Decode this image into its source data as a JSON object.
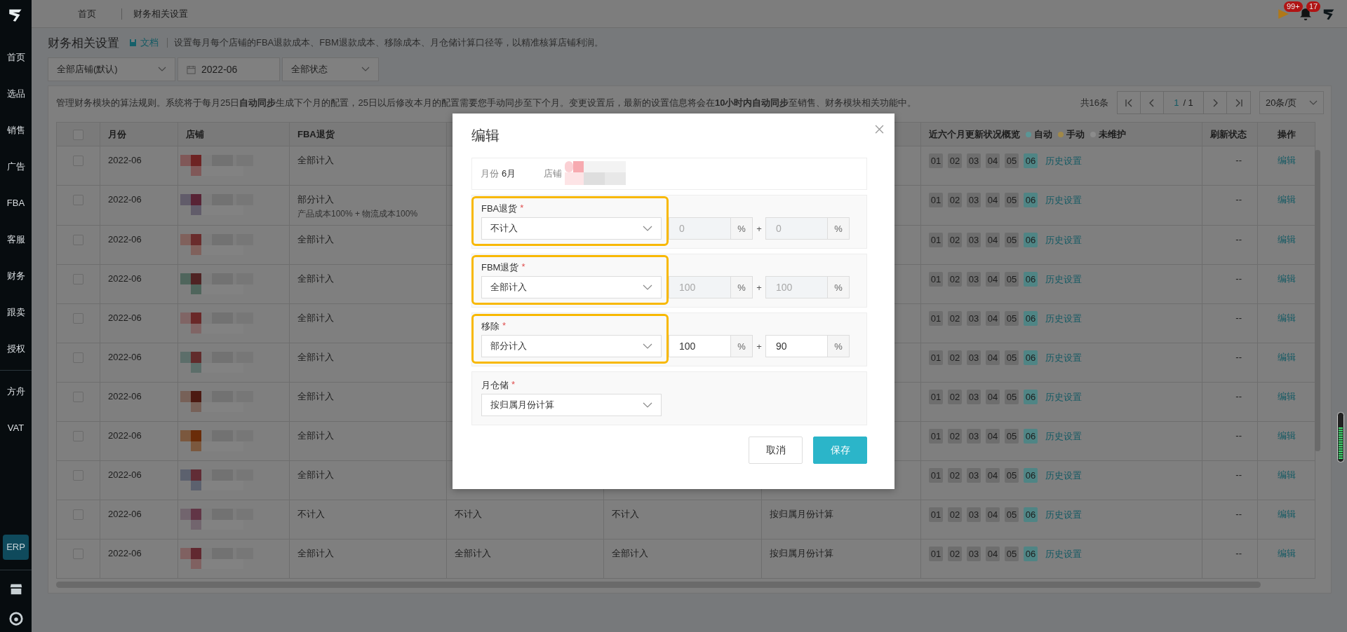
{
  "sidebar": {
    "nav_items": [
      {
        "label": "首页",
        "selected": false
      },
      {
        "label": "选品",
        "selected": false
      },
      {
        "label": "销售",
        "selected": false
      },
      {
        "label": "广告",
        "selected": false
      },
      {
        "label": "FBA",
        "selected": false
      },
      {
        "label": "客服",
        "selected": false
      },
      {
        "label": "财务",
        "selected": false
      },
      {
        "label": "跟卖",
        "selected": false
      },
      {
        "label": "授权",
        "selected": false
      }
    ],
    "extra_items": [
      {
        "label": "方舟",
        "selected": false
      },
      {
        "label": "VAT",
        "selected": false
      }
    ],
    "app_items": [
      {
        "label": "ERP",
        "selected": true
      }
    ]
  },
  "top_bar": {
    "tabs": [
      "首页",
      "财务相关设置"
    ],
    "flag_badge": "99+",
    "bell_badge": "17"
  },
  "page": {
    "title": "财务相关设置",
    "doc_link": "文档",
    "description": "设置每月每个店铺的FBA退款成本、FBM退款成本、移除成本、月仓储计算口径等，以精准核算店铺利润。"
  },
  "filters": {
    "store": "全部店铺(默认)",
    "month": "2022-06",
    "status": "全部状态"
  },
  "notice": "管理财务模块的算法规则。系统将于每月25日**自动同步**生成下个月的配置，25日以后修改本月的配置需要您手动同步至下个月。变更设置后，最新的设置信息将会在**10小时内自动同步**至销售、财务模块相关功能中。",
  "pagination": {
    "total": "共16条",
    "page": "1",
    "pages": "/ 1",
    "page_size": "20条/页"
  },
  "table": {
    "header_checked": false,
    "header": {
      "month": "月份",
      "store": "店铺",
      "fba": "FBA退货",
      "history": "近六个月更新状况概览",
      "refresh": "刷新状态",
      "action": "操作"
    },
    "legend": [
      {
        "label": "自动",
        "color": "#5a9696"
      },
      {
        "label": "手动",
        "color": "#a08848"
      },
      {
        "label": "未维护",
        "color": "#8c8c8c"
      }
    ],
    "rows": [
      {
        "checked": false,
        "month": "2022-06",
        "fba": "全部计入",
        "history": [
          {
            "label": "01",
            "color": "#6e6e6e"
          },
          {
            "label": "02",
            "color": "#6e6e6e"
          },
          {
            "label": "03",
            "color": "#6e6e6e"
          },
          {
            "label": "04",
            "color": "#6e6e6e"
          },
          {
            "label": "05",
            "color": "#6e6e6e"
          },
          {
            "label": "06",
            "color": "#4f8585"
          }
        ],
        "history_link": "历史设置",
        "refresh": "--",
        "action": "编辑"
      },
      {
        "checked": false,
        "month": "2022-06",
        "fba": "部分计入",
        "fba_detail": "产品成本100% + 物流成本100%",
        "history": [
          {
            "label": "01",
            "color": "#6e6e6e"
          },
          {
            "label": "02",
            "color": "#6e6e6e"
          },
          {
            "label": "03",
            "color": "#6e6e6e"
          },
          {
            "label": "04",
            "color": "#6e6e6e"
          },
          {
            "label": "05",
            "color": "#6e6e6e"
          },
          {
            "label": "06",
            "color": "#4f8585"
          }
        ],
        "history_link": "历史设置",
        "refresh": "--",
        "action": "编辑"
      },
      {
        "checked": false,
        "month": "2022-06",
        "fba": "全部计入",
        "history": [
          {
            "label": "01",
            "color": "#6e6e6e"
          },
          {
            "label": "02",
            "color": "#6e6e6e"
          },
          {
            "label": "03",
            "color": "#6e6e6e"
          },
          {
            "label": "04",
            "color": "#6e6e6e"
          },
          {
            "label": "05",
            "color": "#6e6e6e"
          },
          {
            "label": "06",
            "color": "#4f8585"
          }
        ],
        "history_link": "历史设置",
        "refresh": "--",
        "action": "编辑"
      },
      {
        "checked": false,
        "month": "2022-06",
        "fba": "全部计入",
        "history": [
          {
            "label": "01",
            "color": "#6e6e6e"
          },
          {
            "label": "02",
            "color": "#6e6e6e"
          },
          {
            "label": "03",
            "color": "#6e6e6e"
          },
          {
            "label": "04",
            "color": "#6e6e6e"
          },
          {
            "label": "05",
            "color": "#6e6e6e"
          },
          {
            "label": "06",
            "color": "#4f8585"
          }
        ],
        "history_link": "历史设置",
        "refresh": "--",
        "action": "编辑"
      },
      {
        "checked": false,
        "month": "2022-06",
        "fba": "全部计入",
        "history": [
          {
            "label": "01",
            "color": "#6e6e6e"
          },
          {
            "label": "02",
            "color": "#6e6e6e"
          },
          {
            "label": "03",
            "color": "#6e6e6e"
          },
          {
            "label": "04",
            "color": "#6e6e6e"
          },
          {
            "label": "05",
            "color": "#6e6e6e"
          },
          {
            "label": "06",
            "color": "#4f8585"
          }
        ],
        "history_link": "历史设置",
        "refresh": "--",
        "action": "编辑"
      },
      {
        "checked": false,
        "month": "2022-06",
        "fba": "全部计入",
        "history": [
          {
            "label": "01",
            "color": "#6e6e6e"
          },
          {
            "label": "02",
            "color": "#6e6e6e"
          },
          {
            "label": "03",
            "color": "#6e6e6e"
          },
          {
            "label": "04",
            "color": "#6e6e6e"
          },
          {
            "label": "05",
            "color": "#6e6e6e"
          },
          {
            "label": "06",
            "color": "#4f8585"
          }
        ],
        "history_link": "历史设置",
        "refresh": "--",
        "action": "编辑"
      },
      {
        "checked": false,
        "month": "2022-06",
        "fba": "全部计入",
        "history": [
          {
            "label": "01",
            "color": "#6e6e6e"
          },
          {
            "label": "02",
            "color": "#6e6e6e"
          },
          {
            "label": "03",
            "color": "#6e6e6e"
          },
          {
            "label": "04",
            "color": "#6e6e6e"
          },
          {
            "label": "05",
            "color": "#6e6e6e"
          },
          {
            "label": "06",
            "color": "#4f8585"
          }
        ],
        "history_link": "历史设置",
        "refresh": "--",
        "action": "编辑"
      },
      {
        "checked": false,
        "month": "2022-06",
        "fba": "全部计入",
        "history": [
          {
            "label": "01",
            "color": "#6e6e6e"
          },
          {
            "label": "02",
            "color": "#6e6e6e"
          },
          {
            "label": "03",
            "color": "#6e6e6e"
          },
          {
            "label": "04",
            "color": "#6e6e6e"
          },
          {
            "label": "05",
            "color": "#6e6e6e"
          },
          {
            "label": "06",
            "color": "#4f8585"
          }
        ],
        "history_link": "历史设置",
        "refresh": "--",
        "action": "编辑"
      },
      {
        "checked": false,
        "month": "2022-06",
        "fba": "全部计入",
        "history": [
          {
            "label": "01",
            "color": "#6e6e6e"
          },
          {
            "label": "02",
            "color": "#6e6e6e"
          },
          {
            "label": "03",
            "color": "#6e6e6e"
          },
          {
            "label": "04",
            "color": "#6e6e6e"
          },
          {
            "label": "05",
            "color": "#6e6e6e"
          },
          {
            "label": "06",
            "color": "#4f8585"
          }
        ],
        "history_link": "历史设置",
        "refresh": "--",
        "action": "编辑"
      },
      {
        "checked": false,
        "month": "2022-06",
        "fba": "不计入",
        "column_4": "不计入",
        "column_5": "不计入",
        "column_6": "按归属月份计算",
        "history": [
          {
            "label": "01",
            "color": "#6e6e6e"
          },
          {
            "label": "02",
            "color": "#6e6e6e"
          },
          {
            "label": "03",
            "color": "#6e6e6e"
          },
          {
            "label": "04",
            "color": "#6e6e6e"
          },
          {
            "label": "05",
            "color": "#6e6e6e"
          },
          {
            "label": "06",
            "color": "#4f8585"
          }
        ],
        "history_link": "历史设置",
        "refresh": "--",
        "action": "编辑"
      },
      {
        "checked": false,
        "month": "2022-06",
        "fba": "全部计入",
        "column_4": "全部计入",
        "column_5": "全部计入",
        "column_6": "按归属月份计算",
        "history": [
          {
            "label": "01",
            "color": "#6e6e6e"
          },
          {
            "label": "02",
            "color": "#6e6e6e"
          },
          {
            "label": "03",
            "color": "#6e6e6e"
          },
          {
            "label": "04",
            "color": "#6e6e6e"
          },
          {
            "label": "05",
            "color": "#6e6e6e"
          },
          {
            "label": "06",
            "color": "#4f8585"
          }
        ],
        "history_link": "历史设置",
        "refresh": "--",
        "action": "编辑"
      }
    ]
  },
  "dialog": {
    "title": "编辑",
    "summary": {
      "month_label": "月份",
      "month": "6月",
      "store_label": "店铺"
    },
    "sections": [
      {
        "label": "FBA退货",
        "required_mark": "*",
        "highlighted": true,
        "value": "不计入",
        "joiner": "+",
        "inputs": [
          {
            "value": "0",
            "unit": "%",
            "disabled": true
          },
          {
            "value": "0",
            "unit": "%",
            "disabled": true
          }
        ]
      },
      {
        "label": "FBM退货",
        "required_mark": "*",
        "highlighted": true,
        "value": "全部计入",
        "joiner": "+",
        "inputs": [
          {
            "value": "100",
            "unit": "%",
            "disabled": true
          },
          {
            "value": "100",
            "unit": "%",
            "disabled": true
          }
        ]
      },
      {
        "label": "移除",
        "required_mark": "*",
        "highlighted": true,
        "value": "部分计入",
        "joiner": "+",
        "inputs": [
          {
            "value": "100",
            "unit": "%",
            "disabled": false
          },
          {
            "value": "90",
            "unit": "%",
            "disabled": false
          }
        ]
      },
      {
        "label": "月仓储",
        "required_mark": "*",
        "highlighted": false,
        "value": "按归属月份计算"
      }
    ],
    "buttons": [
      {
        "label": "取消",
        "kind": "secondary"
      },
      {
        "label": "保存",
        "kind": "primary"
      }
    ]
  }
}
